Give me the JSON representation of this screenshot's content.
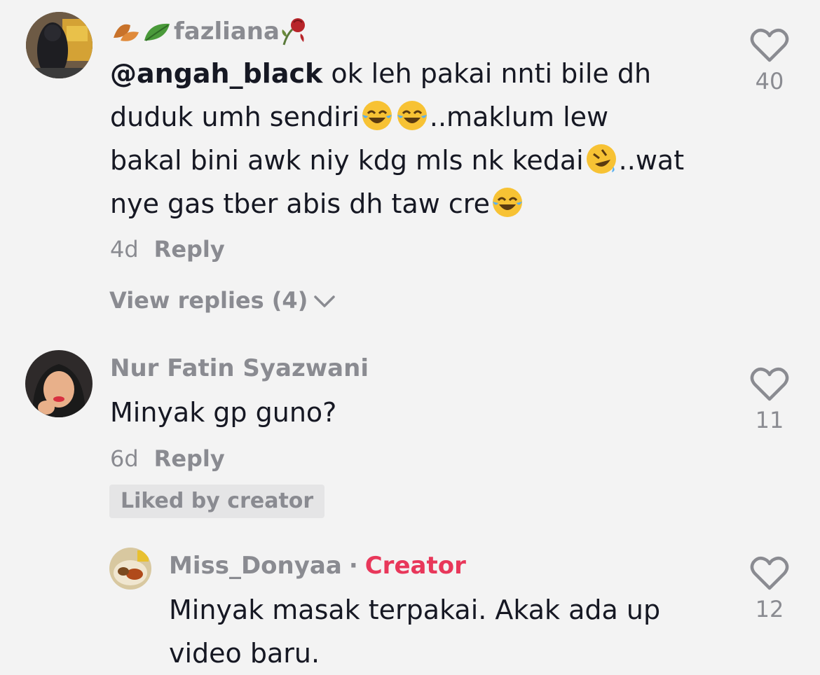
{
  "comments": [
    {
      "username": "fazliana",
      "mention": "@angah_black",
      "lines": [
        " ok leh pakai nnti bile dh",
        "duduk umh sendiri",
        "..maklum lew",
        "bakal bini awk niy kdg mls nk kedai",
        "..wat",
        "nye gas tber abis dh taw cre"
      ],
      "time": "4d",
      "reply_label": "Reply",
      "likes": "40",
      "view_replies": "View replies (4)"
    },
    {
      "username": "Nur Fatin Syazwani",
      "text": "Minyak gp guno?",
      "time": "6d",
      "reply_label": "Reply",
      "likes": "11",
      "badge": "Liked by creator"
    },
    {
      "username": "Miss_Donyaa",
      "creator_label": "Creator",
      "separator": "·",
      "lines": [
        "Minyak masak terpakai. Akak ada up",
        "video baru."
      ],
      "likes": "12"
    }
  ],
  "icons": {
    "like": "heart-outline-icon",
    "expand": "chevron-down-icon",
    "emoji_laugh": "tears-of-joy-emoji",
    "emoji_rofl": "rolling-on-floor-laughing-emoji"
  },
  "colors": {
    "background": "#f3f3f3",
    "text": "#161823",
    "secondary": "#8a8b91",
    "creator": "#e8375a"
  }
}
